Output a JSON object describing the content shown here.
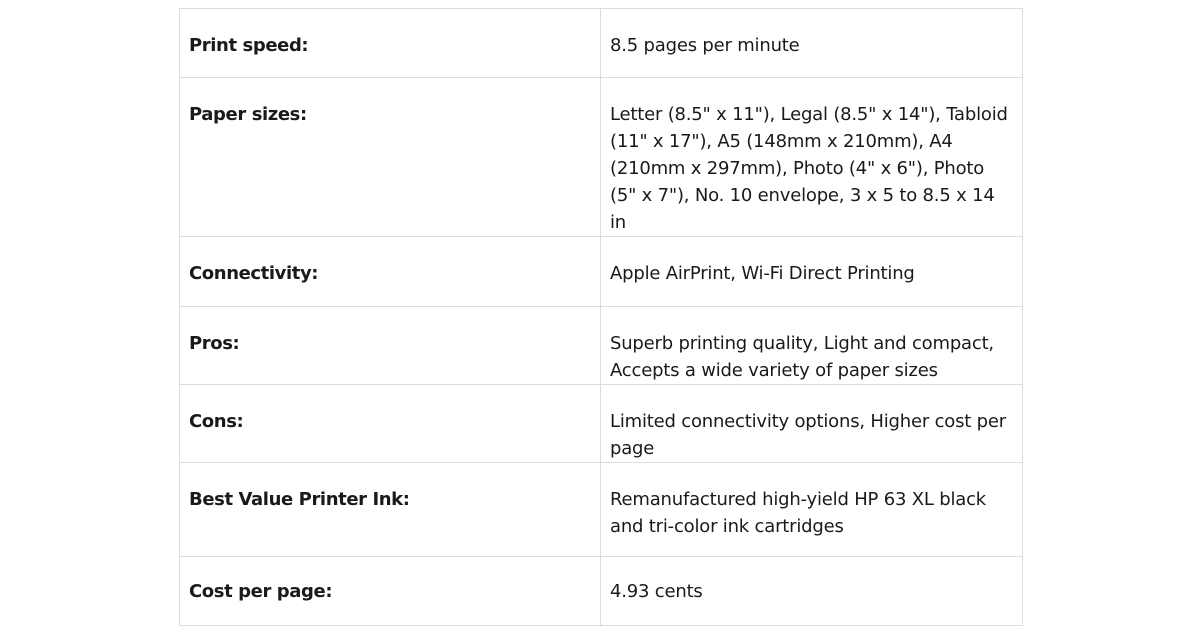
{
  "table": {
    "rows": [
      {
        "label": "Print speed:",
        "value": "8.5 pages per minute"
      },
      {
        "label": "Paper sizes:",
        "value": "Letter (8.5\" x 11\"), Legal (8.5\" x 14\"), Tabloid (11\" x 17\"), A5 (148mm x 210mm), A4 (210mm x 297mm), Photo (4\" x 6\"), Photo (5\" x 7\"), No. 10 envelope, 3 x 5 to 8.5 x 14 in"
      },
      {
        "label": "Connectivity:",
        "value": "Apple AirPrint, Wi-Fi Direct Printing"
      },
      {
        "label": "Pros:",
        "value": "Superb printing quality, Light and compact, Accepts a wide variety of paper sizes"
      },
      {
        "label": "Cons:",
        "value": "Limited connectivity options, Higher cost per page"
      },
      {
        "label": "Best Value Printer Ink:",
        "value": "Remanufactured high-yield HP 63 XL black and tri-color ink cartridges"
      },
      {
        "label": "Cost per page:",
        "value": "4.93 cents"
      }
    ]
  }
}
